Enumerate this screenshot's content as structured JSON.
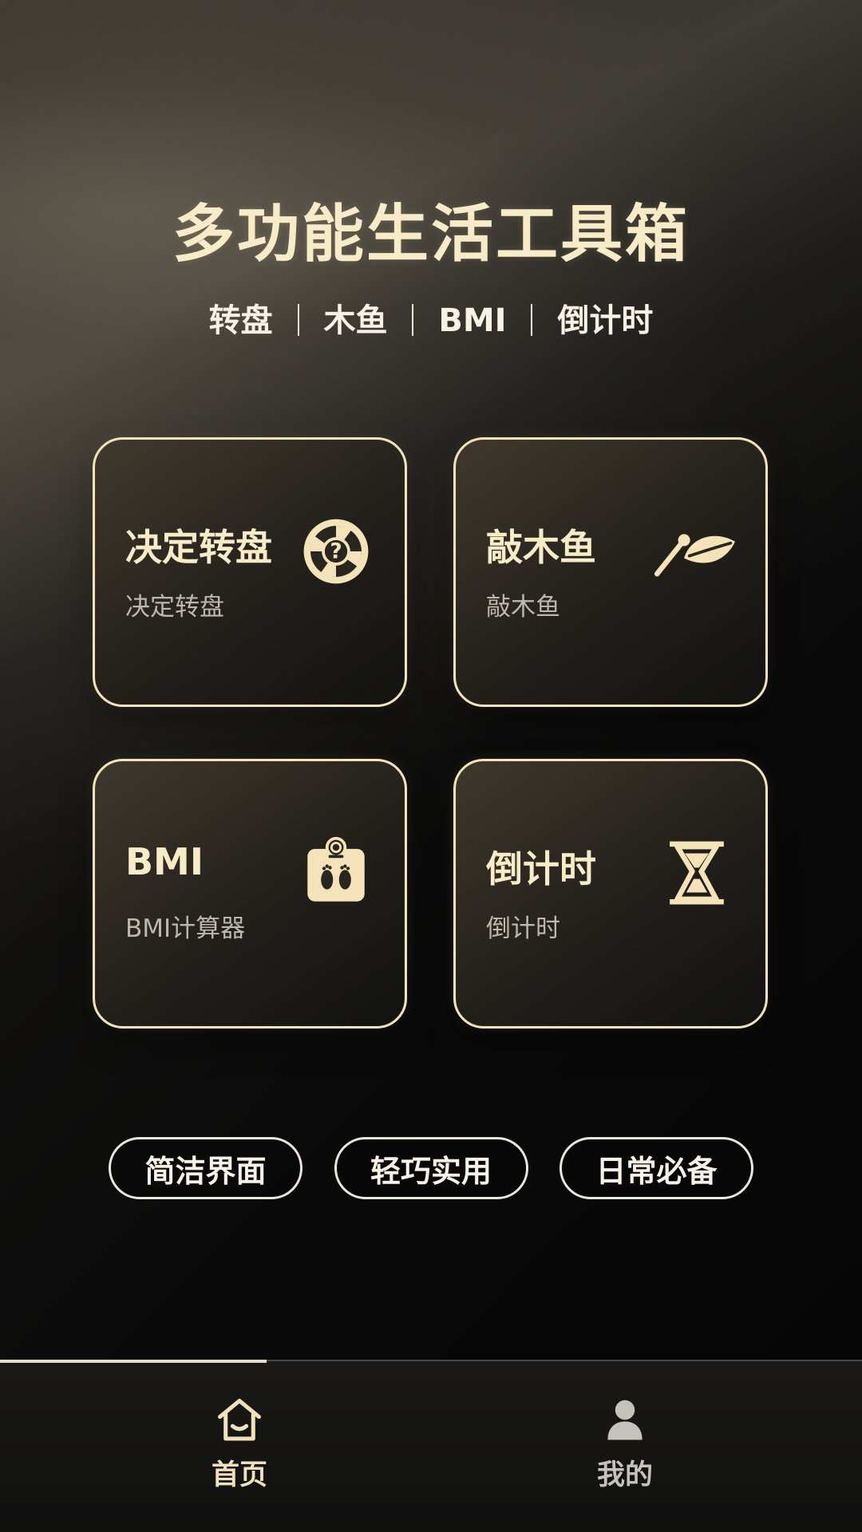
{
  "app": {
    "title": "多功能生活工具箱",
    "features": [
      "转盘",
      "木鱼",
      "BMI",
      "倒计时"
    ]
  },
  "cards": [
    {
      "title": "决定转盘",
      "subtitle": "决定转盘",
      "icon": "wheel-question-icon"
    },
    {
      "title": "敲木鱼",
      "subtitle": "敲木鱼",
      "icon": "wooden-fish-icon"
    },
    {
      "title": "BMI",
      "subtitle": "BMI计算器",
      "icon": "bmi-scale-icon"
    },
    {
      "title": "倒计时",
      "subtitle": "倒计时",
      "icon": "hourglass-icon"
    }
  ],
  "tags": [
    "简洁界面",
    "轻巧实用",
    "日常必备"
  ],
  "bottom_nav": [
    {
      "label": "首页",
      "icon": "home-icon",
      "active": true
    },
    {
      "label": "我的",
      "icon": "profile-icon",
      "active": false
    }
  ],
  "colors": {
    "accent": "#f2e4b8",
    "subtext": "#bdb7ae",
    "inactive": "#c6c2bb"
  }
}
